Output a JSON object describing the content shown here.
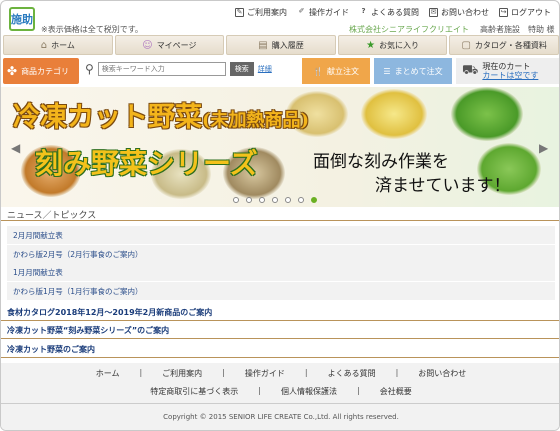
{
  "header": {
    "logo_text": "施助",
    "tax_note": "※表示価格は全て税別です。",
    "top_links": [
      {
        "label": "ご利用案内",
        "icon": "edit-icon"
      },
      {
        "label": "操作ガイド",
        "icon": "pencil-icon"
      },
      {
        "label": "よくある質問",
        "icon": "question-icon"
      },
      {
        "label": "お問い合わせ",
        "icon": "mail-icon"
      },
      {
        "label": "ログアウト",
        "icon": "logout-icon"
      }
    ],
    "company": "株式会社シニアライフクリエイト",
    "facility": "高齢者施設",
    "user": "特助 様"
  },
  "nav": {
    "tabs": [
      {
        "label": "ホーム",
        "icon": "home-icon"
      },
      {
        "label": "マイページ",
        "icon": "face-icon"
      },
      {
        "label": "購入履歴",
        "icon": "cart-icon"
      },
      {
        "label": "お気に入り",
        "icon": "star-icon"
      },
      {
        "label": "カタログ・各種資料",
        "icon": "document-icon"
      }
    ]
  },
  "subbar": {
    "category": "商品カテゴリ",
    "search_placeholder": "検索キーワード入力",
    "search_button": "検索",
    "detail_button": "詳細",
    "menu_order": "献立注文",
    "bulk_order": "まとめて注文",
    "cart_title": "現在のカート",
    "cart_status": "カートは空です"
  },
  "banner": {
    "title_main": "冷凍カット野菜",
    "title_paren": "(未加熱商品)",
    "title_series": "刻み野菜シリーズ",
    "message_line1": "面倒な刻み作業を",
    "message_line2": "済ませています！",
    "prev": "◀",
    "next": "▶",
    "slide_count": 7,
    "active_slide": 7,
    "accent": "#6ab023"
  },
  "news": {
    "heading": "ニュース／トピックス",
    "items": [
      "2月月間献立表",
      "かわら版2月号（2月行事食のご案内）",
      "1月月間献立表",
      "かわら版1月号（1月行事食のご案内）"
    ]
  },
  "announcements": [
    "食材カタログ2018年12月～2019年2月新商品のご案内",
    "冷凍カット野菜“刻み野菜シリーズ”のご案内",
    "冷凍カット野菜のご案内"
  ],
  "footer": {
    "links_row1": [
      "ホーム",
      "ご利用案内",
      "操作ガイド",
      "よくある質問",
      "お問い合わせ"
    ],
    "links_row2": [
      "特定商取引に基づく表示",
      "個人情報保護法",
      "会社概要"
    ],
    "copyright": "Copyright © 2015 SENIOR LIFE CREATE Co.,Ltd. All rights reserved."
  }
}
